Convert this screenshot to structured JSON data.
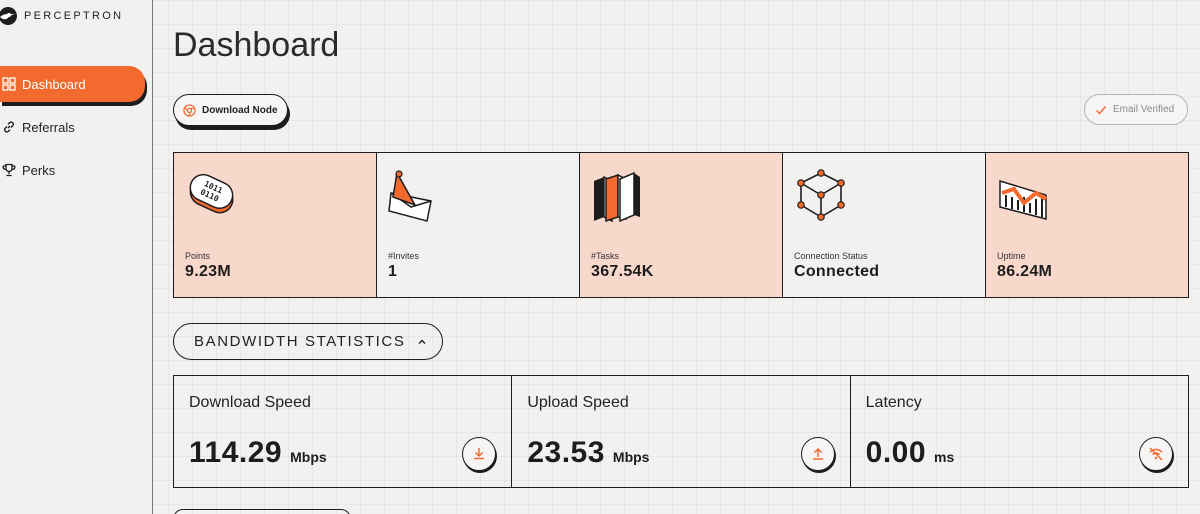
{
  "brand": {
    "name": "PERCEPTRON"
  },
  "sidebar": {
    "items": [
      {
        "label": "Dashboard",
        "icon": "grid-icon",
        "active": true
      },
      {
        "label": "Referrals",
        "icon": "link-icon",
        "active": false
      },
      {
        "label": "Perks",
        "icon": "trophy-icon",
        "active": false
      }
    ]
  },
  "header": {
    "title": "Dashboard",
    "download_label": "Download Node",
    "email_label": "Email Verified"
  },
  "stats": [
    {
      "label": "Points",
      "value": "9.23M",
      "icon": "binary-pill-icon",
      "highlight": true
    },
    {
      "label": "#Invites",
      "value": "1",
      "icon": "envelope-icon",
      "highlight": false
    },
    {
      "label": "#Tasks",
      "value": "367.54K",
      "icon": "books-icon",
      "highlight": true
    },
    {
      "label": "Connection Status",
      "value": "Connected",
      "icon": "network-cube-icon",
      "highlight": false
    },
    {
      "label": "Uptime",
      "value": "86.24M",
      "icon": "chart-icon",
      "highlight": true
    }
  ],
  "bandwidth": {
    "title": "BANDWIDTH STATISTICS",
    "cards": [
      {
        "label": "Download Speed",
        "value": "114.29",
        "unit": "Mbps",
        "icon": "download-icon"
      },
      {
        "label": "Upload Speed",
        "value": "23.53",
        "unit": "Mbps",
        "icon": "upload-icon"
      },
      {
        "label": "Latency",
        "value": "0.00",
        "unit": "ms",
        "icon": "wifi-off-icon"
      }
    ]
  },
  "colors": {
    "accent": "#f26a2e",
    "highlight_bg": "#f9d8cc",
    "ink": "#1d1d1d",
    "background": "#f2f1f0"
  }
}
